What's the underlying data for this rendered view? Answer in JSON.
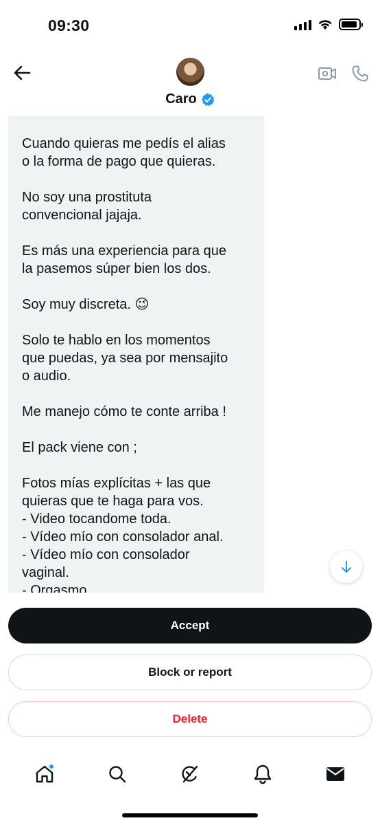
{
  "status_bar": {
    "time": "09:30",
    "battery_level": 0.9
  },
  "header": {
    "name": "Caro",
    "verified": true,
    "icons": [
      "back-arrow-icon",
      "video-camera-icon",
      "phone-icon",
      "verified-badge-icon"
    ]
  },
  "message": {
    "text": "Cuando quieras me pedís el alias\no la forma de pago que quieras.\n\nNo soy una prostituta\nconvencional jajaja.\n\nEs más una experiencia para que\nla pasemos súper bien los dos.\n\nSoy muy discreta. 😉\n\nSolo te hablo en los momentos\nque puedas, ya sea por mensajito\no audio.\n\nMe manejo cómo te conte arriba !\n\nEl pack viene con ;\n\nFotos mías explícitas + las que\nquieras que te haga para vos.\n- Video tocandome toda.\n- Vídeo mío con consolador anal.\n- Vídeo mío con consolador\nvaginal.\n- Orgasmo",
    "bubble_color": "#eff3f4"
  },
  "actions": {
    "accept_label": "Accept",
    "block_label": "Block or report",
    "delete_label": "Delete"
  },
  "tab_bar": {
    "tabs": [
      "home-icon",
      "search-icon",
      "grok-icon",
      "notifications-bell-icon",
      "messages-envelope-icon"
    ],
    "home_has_notification": true
  },
  "colors": {
    "accent": "#1d9bf0",
    "danger": "#f4212e",
    "dark": "#0f1419"
  }
}
